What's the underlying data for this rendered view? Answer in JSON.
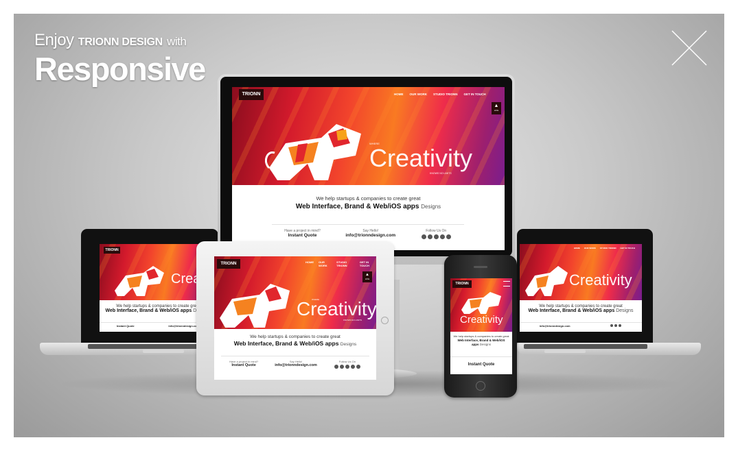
{
  "headline": {
    "prefix": "Enjoy",
    "brand": "TRIONN DESIGN",
    "suffix": "with",
    "title": "Responsive"
  },
  "icons": {
    "close": "close-x-icon"
  },
  "site": {
    "logo": "TRIONN",
    "nav": [
      "HOME",
      "OUR WORK",
      "STUDIO TRIONN",
      "GET IN TOUCH"
    ],
    "hero_small": "WHERE",
    "hero_word": "Creativity",
    "hero_sub": "KNOWS NO LIMITS",
    "like": "LIKE",
    "tagline_top": "We help startups & companies to create great",
    "tagline_bold": "Web Interface, Brand & Web/iOS apps",
    "tagline_suffix": "Designs",
    "project_label": "Have a project in mind?",
    "project_value": "Instant Quote",
    "hello_label": "Say Hello!",
    "hello_value": "info@trionndesign.com",
    "follow_label": "Follow Us On",
    "social": [
      "facebook-icon",
      "linkedin-icon",
      "twitter-icon",
      "dribbble-icon",
      "behance-icon"
    ]
  },
  "colors": {
    "hero_dark": "#8b0d1e",
    "hero_red": "#d31a2c",
    "hero_orange": "#f97a22",
    "hero_purple": "#7a1e8e",
    "logo_bg": "#2a0b0b"
  }
}
